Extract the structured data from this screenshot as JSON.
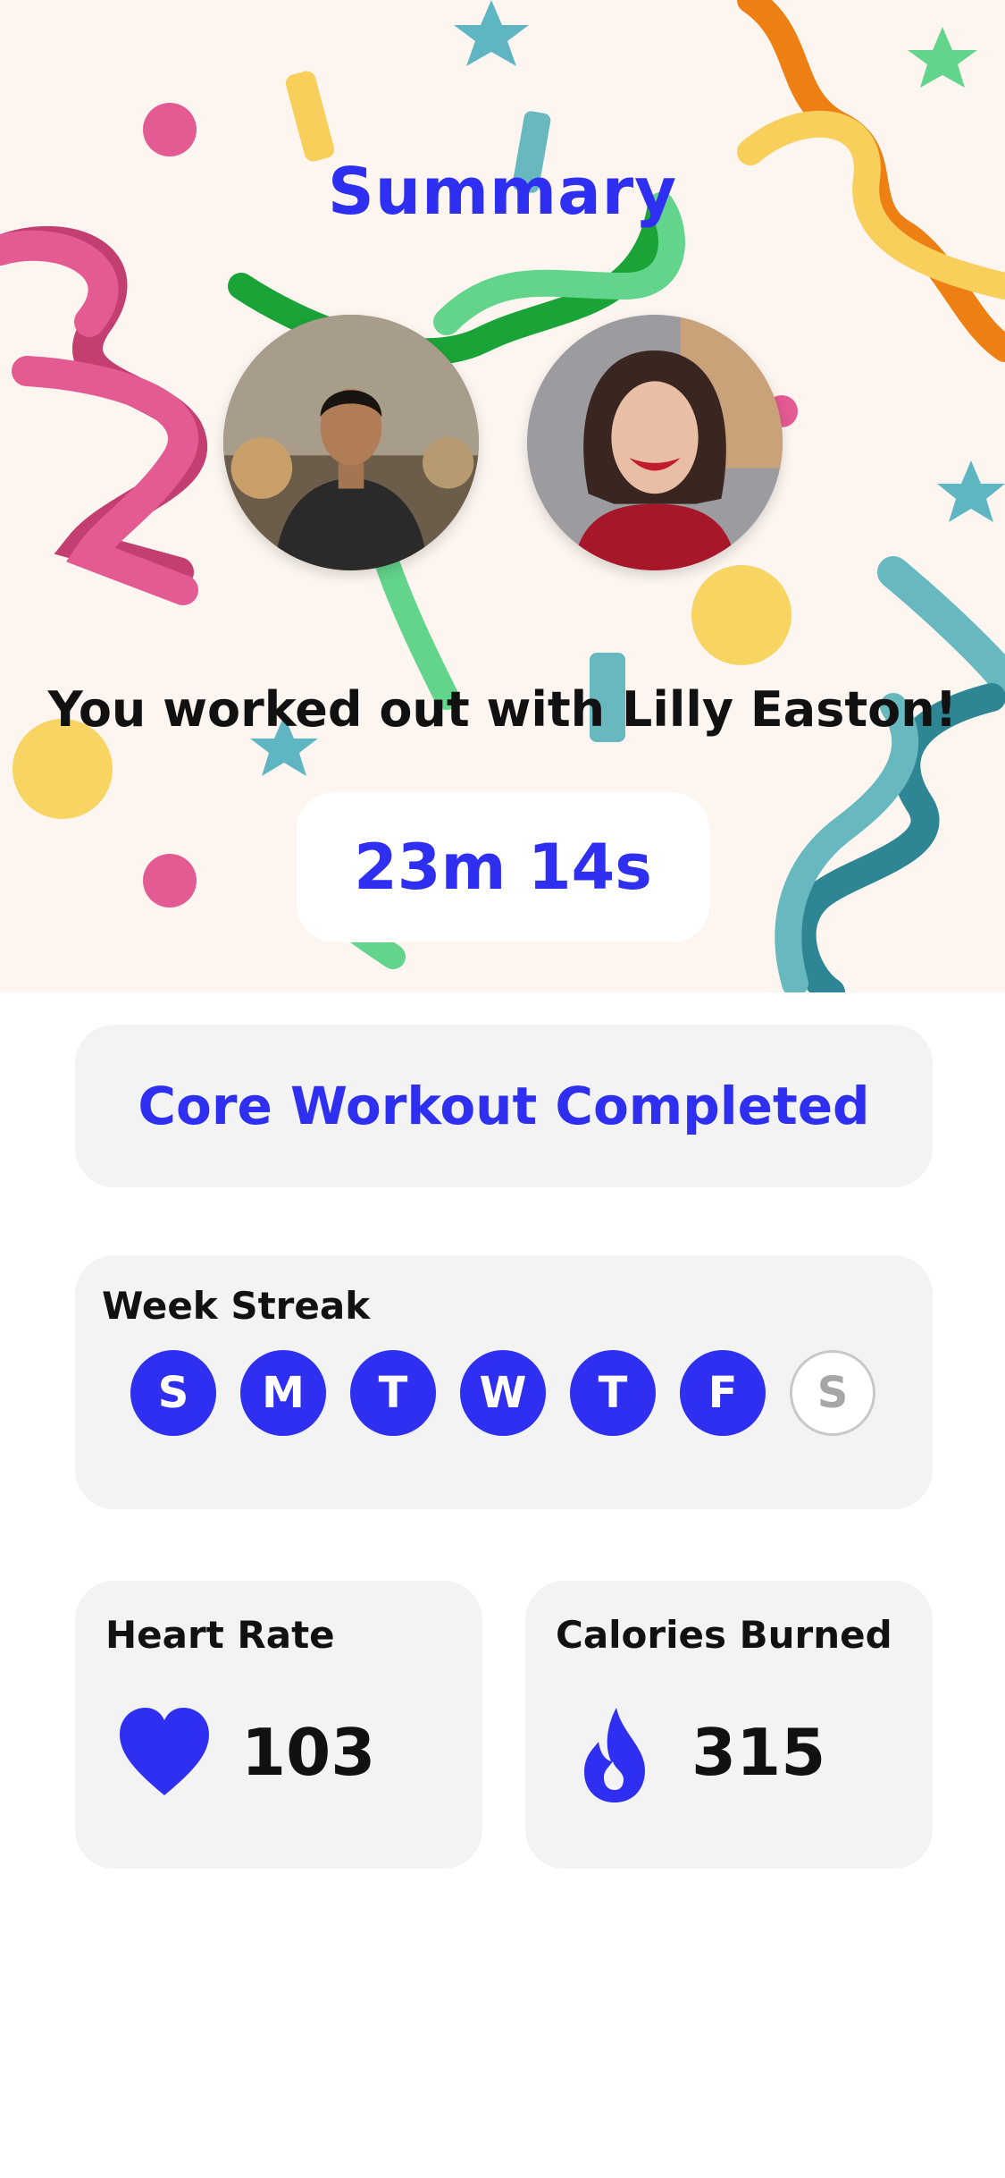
{
  "header": {
    "title": "Summary"
  },
  "participants": {
    "avatar_1_alt": "Workout partner photo",
    "avatar_2_alt": "Lilly Easton photo"
  },
  "tagline": "You worked out with Lilly Easton!",
  "duration": "23m 14s",
  "completion": {
    "label": "Core Workout Completed"
  },
  "streak": {
    "label": "Week Streak",
    "days": [
      {
        "letter": "S",
        "done": true
      },
      {
        "letter": "M",
        "done": true
      },
      {
        "letter": "T",
        "done": true
      },
      {
        "letter": "W",
        "done": true
      },
      {
        "letter": "T",
        "done": true
      },
      {
        "letter": "F",
        "done": true
      },
      {
        "letter": "S",
        "done": false
      }
    ]
  },
  "metrics": {
    "heart_rate": {
      "label": "Heart Rate",
      "value": "103",
      "icon": "heart-icon"
    },
    "calories": {
      "label": "Calories Burned",
      "value": "315",
      "icon": "flame-icon"
    }
  },
  "colors": {
    "accent": "#2f2ff2",
    "hero_background": "#fdf6f0",
    "card_background": "#f3f3f3"
  }
}
